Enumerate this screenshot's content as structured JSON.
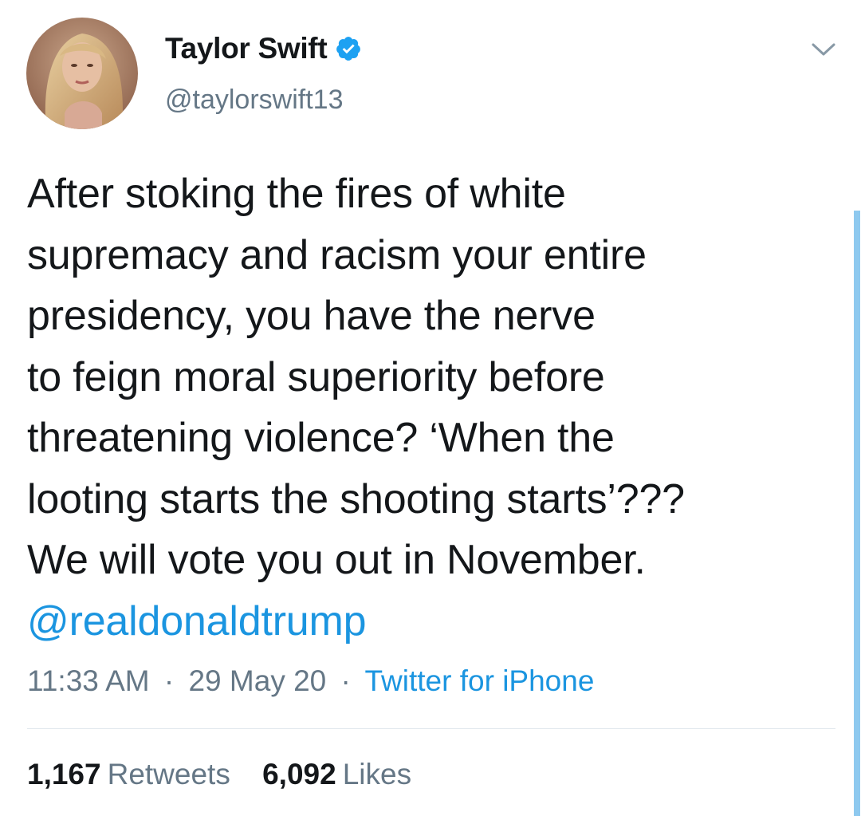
{
  "author": {
    "display_name": "Taylor Swift",
    "handle": "@taylorswift13",
    "verified": true
  },
  "tweet": {
    "lines": [
      "After stoking the fires of white",
      "supremacy and racism your entire",
      "presidency, you have the nerve",
      "to feign moral superiority before",
      "threatening violence? ‘When the",
      "looting starts the shooting starts’???",
      "We will vote you out in November."
    ],
    "mention": "@realdonaldtrump"
  },
  "meta": {
    "time": "11:33 AM",
    "separator": "·",
    "date": "29 May 20",
    "source": "Twitter for iPhone"
  },
  "stats": {
    "retweets_count": "1,167",
    "retweets_label": "Retweets",
    "likes_count": "6,092",
    "likes_label": "Likes"
  },
  "icons": {
    "verified": "verified-badge-icon",
    "menu": "chevron-down-icon"
  },
  "colors": {
    "link": "#1b95e0",
    "secondary_text": "#657786",
    "primary_text": "#14171a",
    "verified": "#1da1f2"
  }
}
